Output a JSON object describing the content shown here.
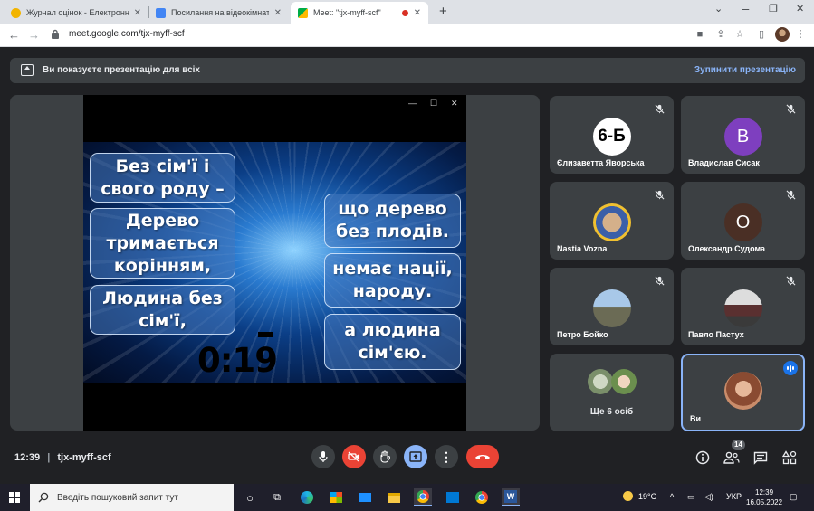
{
  "browser": {
    "tabs": [
      {
        "title": "Журнал оцінок - Електронні щ",
        "active": false
      },
      {
        "title": "Посилання на відеокімнати - Go",
        "active": false
      },
      {
        "title": "Meet: \"tjx-myff-scf\"",
        "active": true
      }
    ],
    "url": "meet.google.com/tjx-myff-scf"
  },
  "banner": {
    "text": "Ви показуєте презентацію для всіх",
    "stop_label": "Зупинити презентацію"
  },
  "slide": {
    "left_cards": [
      "Без сім'ї і свого роду –",
      "Дерево тримається корінням,",
      "Людина без сім'ї,"
    ],
    "right_cards": [
      "що дерево без плодів.",
      "немає нації, народу.",
      "а людина сім'єю."
    ],
    "timer": "0:19"
  },
  "participants": [
    {
      "name": "Єлизаветта Яворська",
      "avatar": "6-Б",
      "muted": true
    },
    {
      "name": "Владислав Сисак",
      "avatar": "В",
      "muted": true
    },
    {
      "name": "Nastia Vozna",
      "avatar": "",
      "muted": true
    },
    {
      "name": "Олександр Судома",
      "avatar": "О",
      "muted": true
    },
    {
      "name": "Петро Бойко",
      "avatar": "",
      "muted": true
    },
    {
      "name": "Павло Пастух",
      "avatar": "",
      "muted": true
    }
  ],
  "more_tile": {
    "label": "Ще 6 осіб"
  },
  "self_tile": {
    "name": "Ви",
    "speaking": true
  },
  "meeting": {
    "time": "12:39",
    "code": "tjx-myff-scf",
    "participant_count": "14"
  },
  "icons": {
    "mic": "mic-icon",
    "camera_off": "video-off-icon",
    "raise_hand": "hand-icon",
    "present": "present-icon",
    "more": "more-vert-icon",
    "hangup": "call-end-icon",
    "info": "info-icon",
    "people": "people-icon",
    "chat": "chat-icon",
    "activities": "activities-icon"
  },
  "taskbar": {
    "search_placeholder": "Введіть пошуковий запит тут",
    "weather": "19°C",
    "language": "УКР",
    "time": "12:39",
    "date": "16.05.2022"
  },
  "colors": {
    "meet_bg": "#202124",
    "tile_bg": "#3c4043",
    "accent_blue": "#8ab4f8",
    "danger_red": "#ea4335"
  }
}
